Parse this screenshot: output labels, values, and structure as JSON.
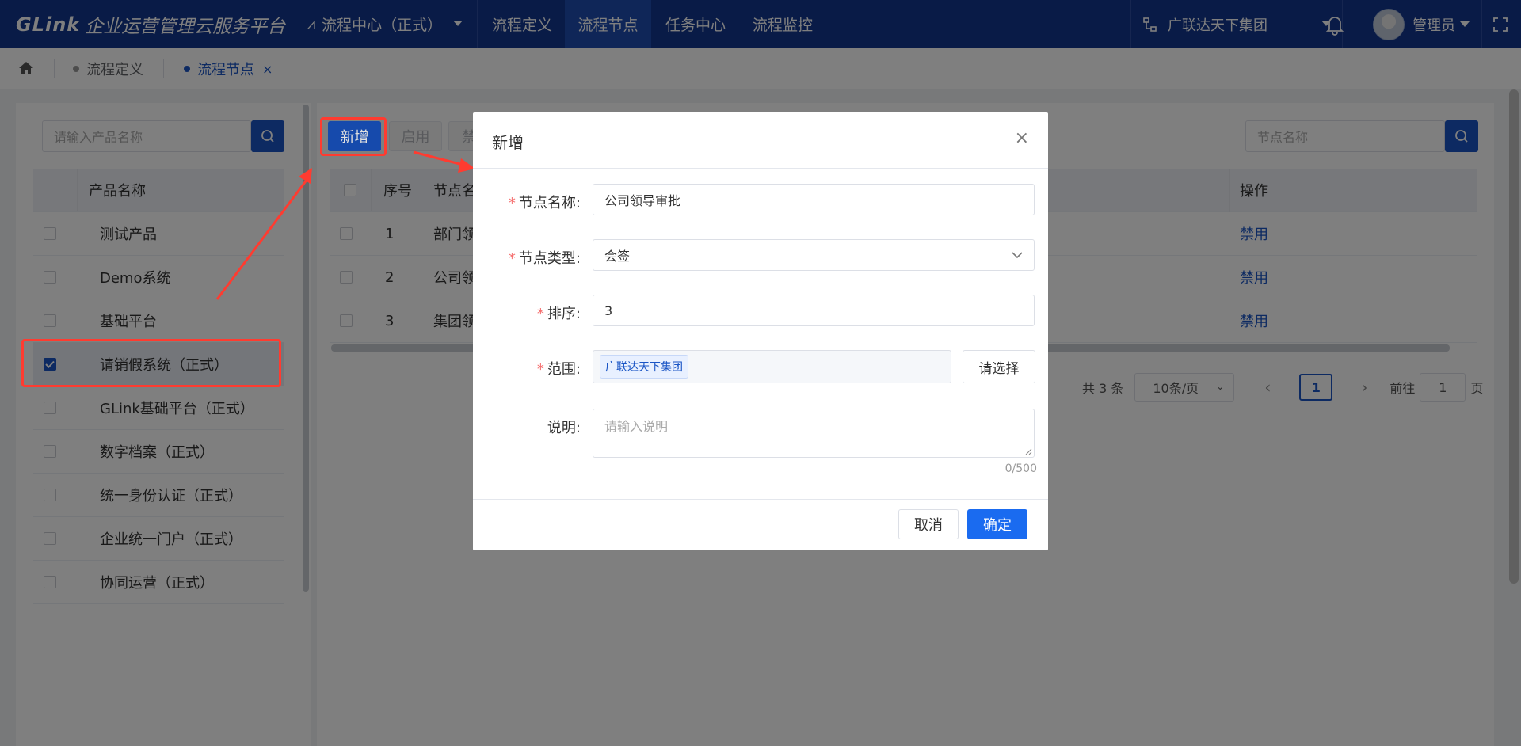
{
  "app": {
    "brand": "GLink",
    "title": "企业运营管理云服务平台"
  },
  "topnav": {
    "module": "流程中心（正式）",
    "tabs": [
      {
        "label": "流程定义"
      },
      {
        "label": "流程节点"
      },
      {
        "label": "任务中心"
      },
      {
        "label": "流程监控"
      }
    ],
    "active_tab": "流程节点",
    "org": "广联达天下集团",
    "user": "管理员"
  },
  "breadcrumbs": [
    {
      "label": "流程定义"
    },
    {
      "label": "流程节点"
    }
  ],
  "left_panel": {
    "search_placeholder": "请输入产品名称",
    "header": "产品名称",
    "items": [
      {
        "label": "测试产品",
        "checked": false
      },
      {
        "label": "Demo系统",
        "checked": false
      },
      {
        "label": "基础平台",
        "checked": false
      },
      {
        "label": "请销假系统（正式）",
        "checked": true
      },
      {
        "label": "GLink基础平台（正式）",
        "checked": false
      },
      {
        "label": "数字档案（正式）",
        "checked": false
      },
      {
        "label": "统一身份认证（正式）",
        "checked": false
      },
      {
        "label": "企业统一门户（正式）",
        "checked": false
      },
      {
        "label": "协同运营（正式）",
        "checked": false
      }
    ]
  },
  "main": {
    "toolbar": {
      "add": "新增",
      "enable": "启用",
      "disable": "禁"
    },
    "search_placeholder": "节点名称",
    "columns": {
      "index": "序号",
      "name": "节点名",
      "action": "操作"
    },
    "rows": [
      {
        "index": "1",
        "name": "部门领",
        "action": "禁用"
      },
      {
        "index": "2",
        "name": "公司领",
        "action": "禁用"
      },
      {
        "index": "3",
        "name": "集团领",
        "action": "禁用"
      }
    ],
    "pagination": {
      "total": "共 3 条",
      "page_size": "10条/页",
      "current": "1",
      "goto_label": "前往",
      "goto_value": "1",
      "page_unit": "页"
    }
  },
  "dialog": {
    "title": "新增",
    "fields": {
      "name_label": "节点名称:",
      "name_value": "公司领导审批",
      "type_label": "节点类型:",
      "type_value": "会签",
      "sort_label": "排序:",
      "sort_value": "3",
      "scope_label": "范围:",
      "scope_tag": "广联达天下集团",
      "scope_button": "请选择",
      "desc_label": "说明:",
      "desc_placeholder": "请输入说明",
      "desc_counter": "0/500"
    },
    "cancel": "取消",
    "confirm": "确定"
  },
  "colors": {
    "primary": "#1a55c5",
    "topbar": "#12368f",
    "annotation": "#ff3b30"
  }
}
